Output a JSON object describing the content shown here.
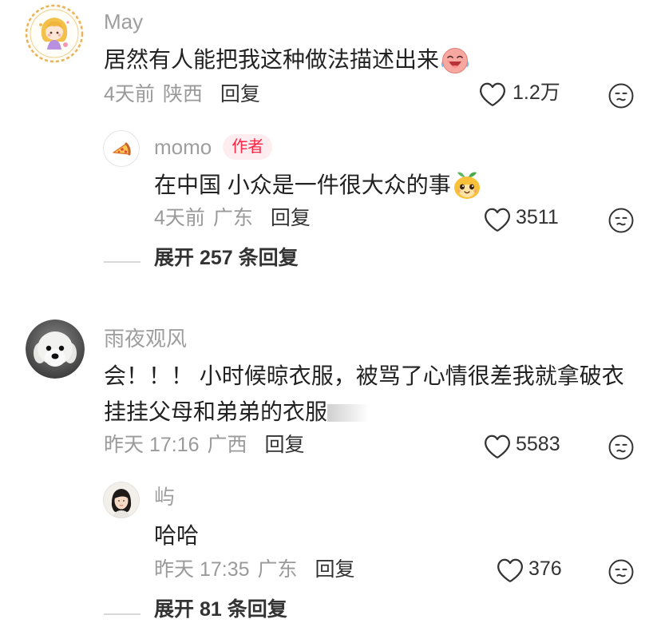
{
  "colors": {
    "background": "#ffffff",
    "author_name": "#9e9e9e",
    "comment_text": "#222222",
    "meta_text": "#9a9a9a",
    "action_text": "#333333",
    "author_badge_bg": "#fdedf0",
    "author_badge_text": "#ff2442",
    "divider": "#d8d8d8"
  },
  "icons": {
    "like": "heart-outline-icon",
    "dislike": "neutral-face-icon"
  },
  "comments": [
    {
      "avatar": "cartoon-girl-avatar",
      "author": "May",
      "text": "居然有人能把我这种做法描述出来",
      "emoji": "crying-laughing-emoji",
      "time": "4天前",
      "location": "陕西",
      "reply_label": "回复",
      "likes": "1.2万",
      "replies": [
        {
          "avatar": "pizza-slice-avatar",
          "author": "momo",
          "badge": "作者",
          "text": "在中国 小众是一件很大众的事",
          "emoji": "mango-face-emoji",
          "time": "4天前",
          "location": "广东",
          "reply_label": "回复",
          "likes": "3511"
        }
      ],
      "expand_label": "展开 257 条回复"
    },
    {
      "avatar": "white-dog-avatar",
      "author": "雨夜观风",
      "text": "会！！！ 小时候晾衣服，被骂了心情很差我就拿破衣挂挂父母和弟弟的衣服",
      "time": "昨天 17:16",
      "location": "广西",
      "reply_label": "回复",
      "likes": "5583",
      "replies": [
        {
          "avatar": "woman-portrait-avatar",
          "author": "屿",
          "text": "哈哈",
          "time": "昨天 17:35",
          "location": "广东",
          "reply_label": "回复",
          "likes": "376"
        }
      ],
      "expand_label": "展开 81 条回复"
    }
  ]
}
